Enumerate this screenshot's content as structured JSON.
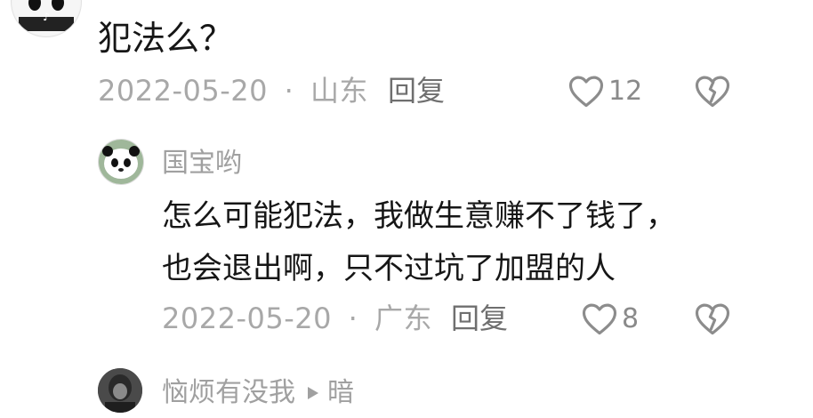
{
  "comment1": {
    "text": "犯法么？",
    "date": "2022-05-20",
    "location": "山东",
    "reply_label": "回复",
    "likes": "12"
  },
  "reply1": {
    "username": "国宝哟",
    "text_line1": "怎么可能犯法，我做生意赚不了钱了，",
    "text_line2": "也会退出啊，只不过坑了加盟的人",
    "date": "2022-05-20",
    "location": "广东",
    "reply_label": "回复",
    "likes": "8"
  },
  "reply2": {
    "username": "恼烦有没我",
    "reply_to": "暗"
  },
  "separator": "·"
}
